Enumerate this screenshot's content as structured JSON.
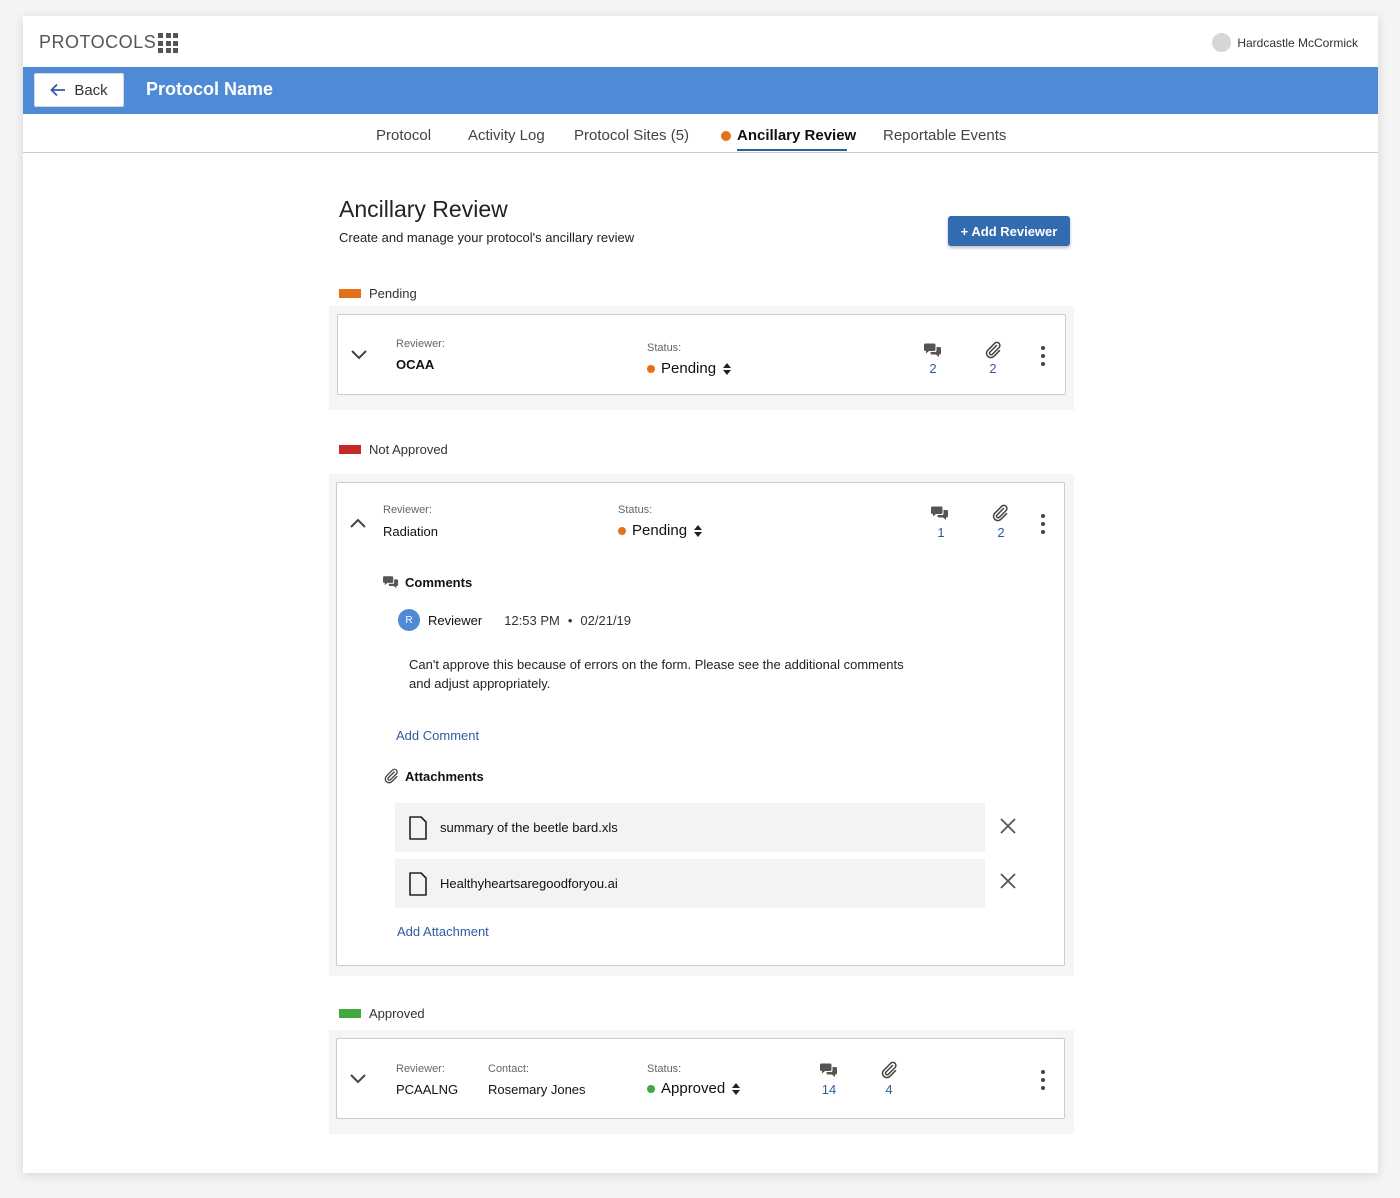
{
  "app": {
    "title": "PROTOCOLS",
    "user_name": "Hardcastle McCormick"
  },
  "header": {
    "back_label": "Back",
    "protocol_name": "Protocol Name"
  },
  "tabs": [
    {
      "label": "Protocol"
    },
    {
      "label": "Activity Log"
    },
    {
      "label": "Protocol Sites (5)"
    },
    {
      "label": "Ancillary Review"
    },
    {
      "label": "Reportable Events"
    }
  ],
  "page": {
    "title": "Ancillary Review",
    "subtitle": "Create and manage your protocol's ancillary review",
    "add_reviewer_label": "+ Add Reviewer"
  },
  "colors": {
    "pending": "#e4701a",
    "not_approved": "#c62828",
    "approved": "#43a83f",
    "accent": "#4f8ad6"
  },
  "sections": {
    "pending": {
      "label": "Pending",
      "card": {
        "reviewer_label": "Reviewer:",
        "reviewer": "OCAA",
        "status_label": "Status:",
        "status": "Pending",
        "comments": "2",
        "attachments": "2"
      }
    },
    "not_approved": {
      "label": "Not Approved",
      "card": {
        "reviewer_label": "Reviewer:",
        "reviewer": "Radiation",
        "status_label": "Status:",
        "status": "Pending",
        "comments": "1",
        "attachments": "2",
        "comments_heading": "Comments",
        "comment": {
          "avatar_initial": "R",
          "author": "Reviewer",
          "time": "12:53 PM",
          "date": "02/21/19",
          "text_line1": "Can't approve this because of errors on the form. Please see the additional comments",
          "text_line2": "and adjust appropriately."
        },
        "add_comment_label": "Add Comment",
        "attachments_heading": "Attachments",
        "files": [
          "summary of the beetle bard.xls",
          "Healthyheartsaregoodforyou.ai"
        ],
        "add_attachment_label": "Add Attachment"
      }
    },
    "approved": {
      "label": "Approved",
      "card": {
        "reviewer_label": "Reviewer:",
        "reviewer": "PCAALNG",
        "contact_label": "Contact:",
        "contact": "Rosemary Jones",
        "status_label": "Status:",
        "status": "Approved",
        "comments": "14",
        "attachments": "4"
      }
    }
  },
  "icons": {
    "grid": "apps-grid-icon",
    "back": "arrow-left-icon",
    "comments": "chat-bubbles-icon",
    "attachments": "paperclip-icon",
    "file": "document-icon",
    "remove": "close-icon",
    "more": "kebab-menu-icon",
    "expand": "chevron-down-icon",
    "collapse": "chevron-up-icon",
    "sort": "sort-arrows-icon"
  }
}
